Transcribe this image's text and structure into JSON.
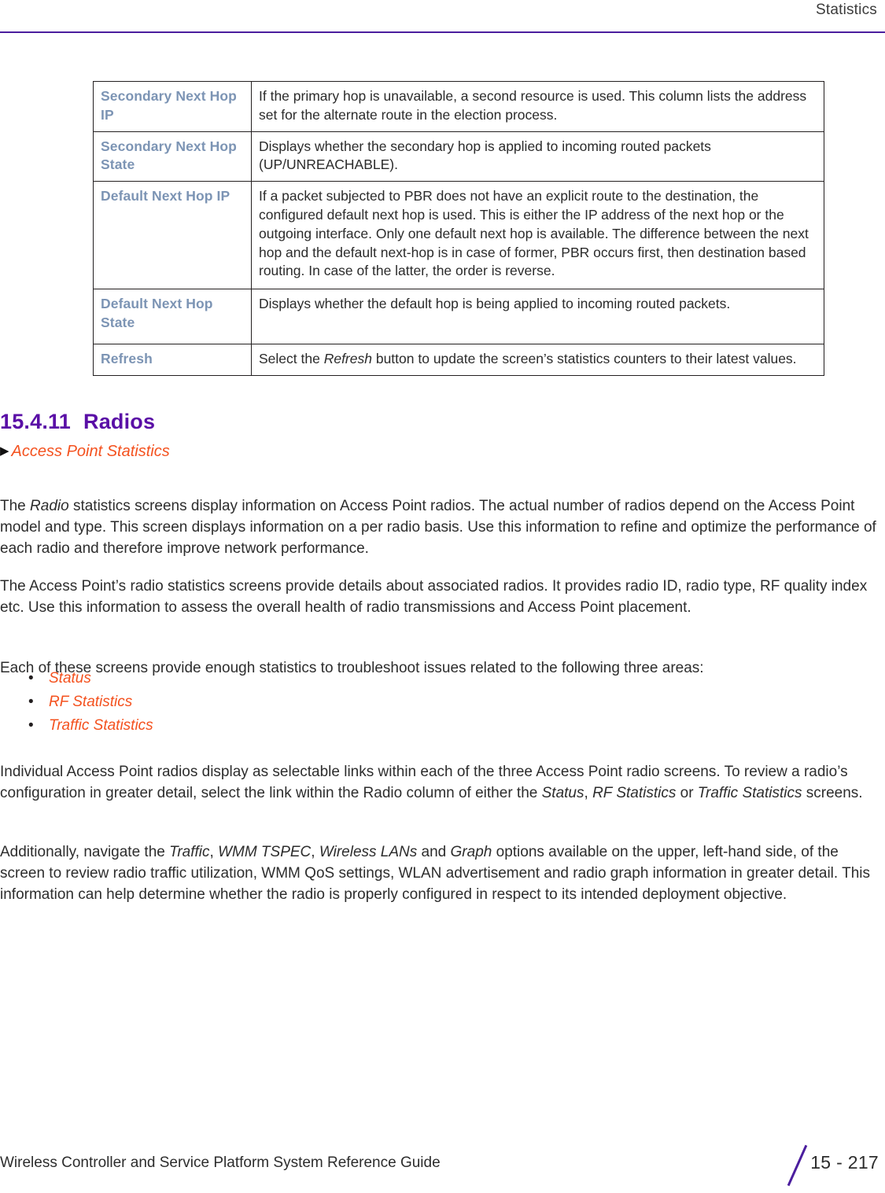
{
  "header": {
    "title": "Statistics",
    "rule_color": "#4B1E9E"
  },
  "colors": {
    "heading_purple": "#5A0FA6",
    "link_orange": "#F4511E",
    "table_label_blue": "#7C94B4",
    "body_text": "#2D2D2D",
    "table_border": "#231F20"
  },
  "param_table": {
    "rows": [
      {
        "label": "Secondary Next Hop IP",
        "description": "If the primary hop is unavailable, a second resource is used. This column lists the address set for the alternate route in the election process."
      },
      {
        "label": "Secondary Next Hop State",
        "description": "Displays whether the secondary hop is applied to incoming routed packets (UP/UNREACHABLE)."
      },
      {
        "label": "Default Next Hop IP",
        "description": "If a packet subjected to PBR does not have an explicit route to the destination, the configured default next hop is used. This is either the IP address of the next hop or the outgoing interface. Only one default next hop is available. The difference between the next hop and the default next-hop is in case of former, PBR occurs first, then destination based routing. In case of the latter, the order is reverse."
      },
      {
        "label": "Default Next Hop State",
        "description": "Displays whether the default hop is being applied to incoming routed packets."
      },
      {
        "label": "Refresh",
        "description_pre": "Select the ",
        "description_em": "Refresh",
        "description_post": " button to update the screen’s statistics counters to their latest values."
      }
    ]
  },
  "section": {
    "number": "15.4.11",
    "title": "Radios",
    "crossref_marker": "▶",
    "crossref_label": "Access Point Statistics"
  },
  "paragraphs": {
    "p1_a": "The ",
    "p1_em": "Radio",
    "p1_b": " statistics screens display information on Access Point radios. The actual number of radios depend on the Access Point model and type. This screen displays information on a per radio basis. Use this information to refine and optimize the performance of each radio and therefore improve network performance.",
    "p2": "The Access Point’s radio statistics screens provide details about associated radios. It provides radio ID, radio type, RF quality index etc. Use this information to assess the overall health of radio transmissions and Access Point placement.",
    "p3": "Each of these screens provide enough statistics to troubleshoot issues related to the following three areas:",
    "p4_a": "Individual Access Point radios display as selectable links within each of the three Access Point radio screens. To review a radio’s configuration in greater detail, select the link within the Radio column of either the ",
    "p4_em1": "Status",
    "p4_b": ", ",
    "p4_em2": "RF Statistics",
    "p4_c": " or ",
    "p4_em3": "Traffic Statistics",
    "p4_d": " screens.",
    "p5_a": "Additionally, navigate the ",
    "p5_em1": "Traffic",
    "p5_b": ", ",
    "p5_em2": "WMM TSPEC",
    "p5_c": ", ",
    "p5_em3": "Wireless LANs",
    "p5_d": " and ",
    "p5_em4": "Graph",
    "p5_e": " options available on the upper, left-hand side, of the screen to review radio traffic utilization, WMM QoS settings, WLAN advertisement and radio graph information in greater detail. This information can help determine whether the radio is properly configured in respect to its intended deployment objective."
  },
  "bullets": {
    "marker": "•",
    "items": [
      {
        "label": "Status"
      },
      {
        "label": "RF Statistics"
      },
      {
        "label": "Traffic Statistics"
      }
    ]
  },
  "footer": {
    "guide_title": "Wireless Controller and Service Platform System Reference Guide",
    "page_number": "15 - 217"
  }
}
